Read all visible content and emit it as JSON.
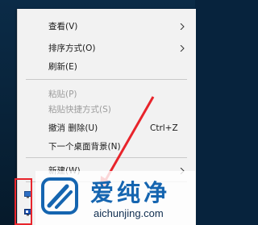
{
  "menu": {
    "items": [
      {
        "label": "查看(V)",
        "submenu": true
      },
      {
        "label": "排序方式(O)",
        "submenu": true
      },
      {
        "label": "刷新(E)"
      },
      {
        "label": "粘贴(P)",
        "disabled": true
      },
      {
        "label": "粘贴快捷方式(S)",
        "disabled": true
      },
      {
        "label": "撤消 删除(U)",
        "shortcut": "Ctrl+Z"
      },
      {
        "label": "下一个桌面背景(N)"
      },
      {
        "label": "新建(W)",
        "submenu": true
      }
    ]
  },
  "watermark": {
    "title": "爱纯净",
    "url": "aichunjing.com"
  },
  "colors": {
    "highlight": "#e8242b",
    "brand": "#1565b0"
  }
}
